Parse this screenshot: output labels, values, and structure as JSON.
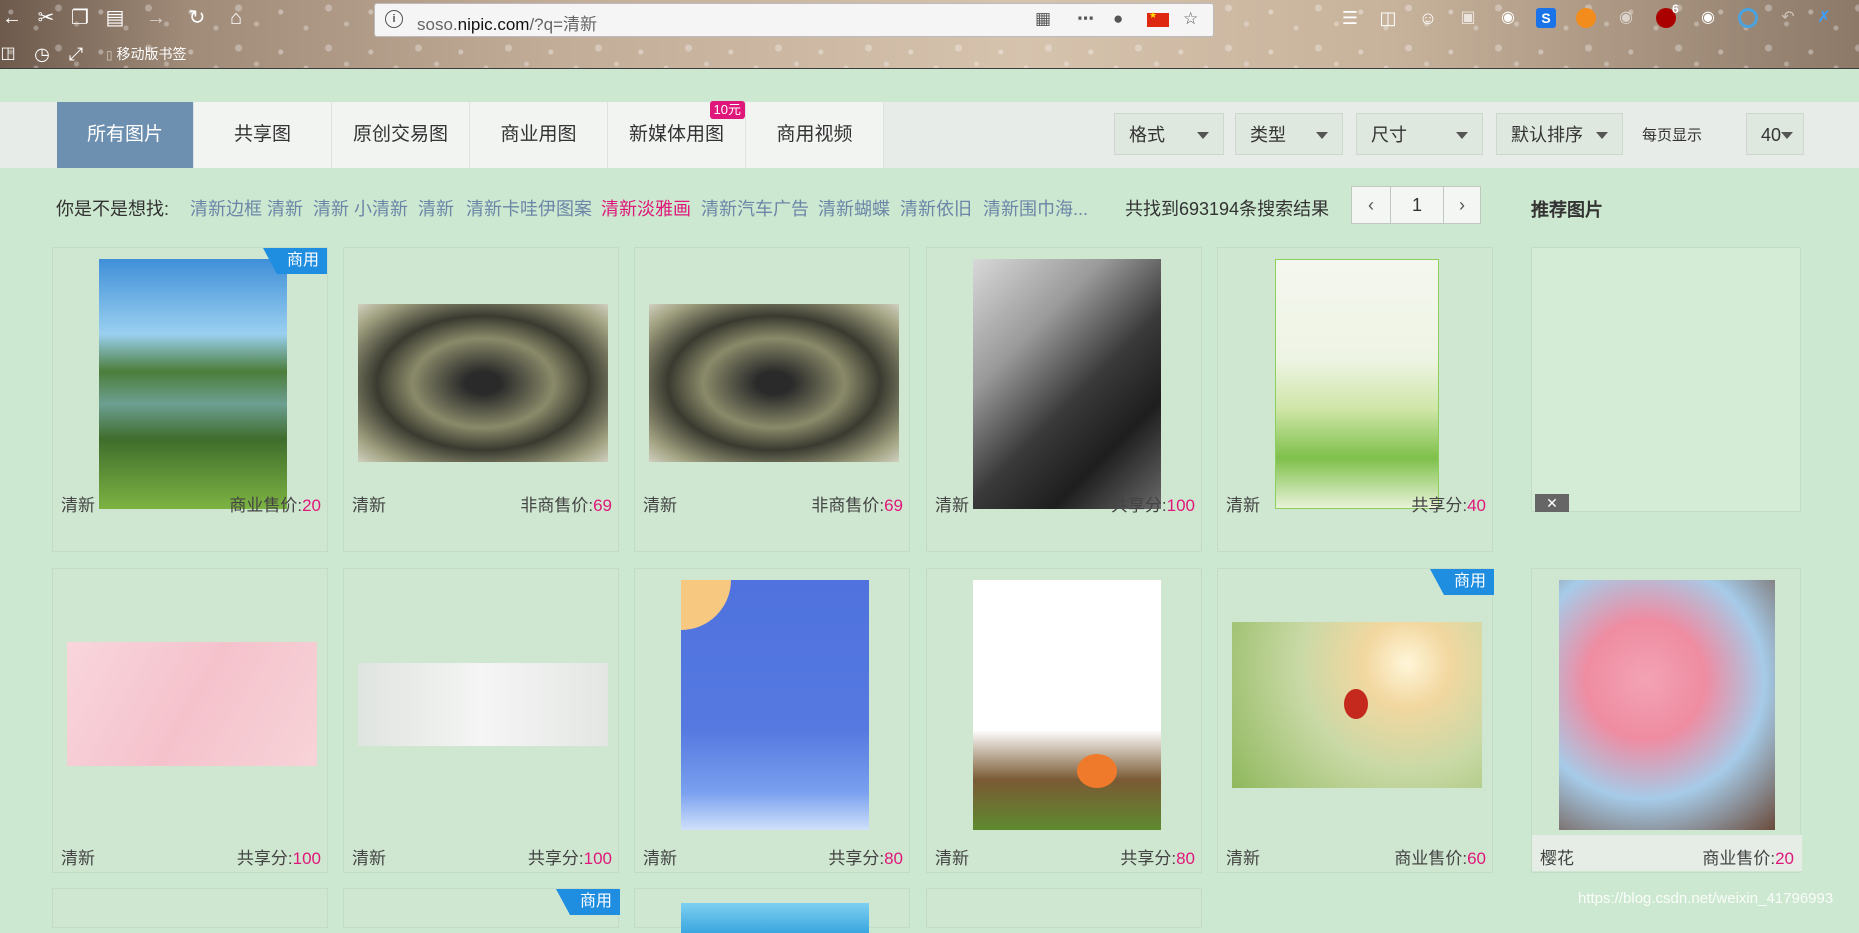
{
  "browser": {
    "url_host": "soso.",
    "url_domain": "nipic.com",
    "url_path": "/?q=清新",
    "bookmark_mobile": "移动版书签",
    "ext_badge": "6"
  },
  "tabs": [
    {
      "label": "所有图片"
    },
    {
      "label": "共享图"
    },
    {
      "label": "原创交易图"
    },
    {
      "label": "商业用图"
    },
    {
      "label": "新媒体用图",
      "badge": "10元"
    },
    {
      "label": "商用视频"
    }
  ],
  "filters": {
    "format": "格式",
    "type": "类型",
    "size": "尺寸",
    "sort": "默认排序",
    "per_page_label": "每页显示",
    "per_page_value": "40"
  },
  "suggestions": {
    "label": "你是不是想找:",
    "items": [
      "清新边框 清新",
      "清新 小清新",
      "清新",
      "清新卡哇伊图案",
      "清新淡雅画",
      "清新汽车广告",
      "清新蝴蝶",
      "清新依旧",
      "清新围巾海..."
    ],
    "highlighted_index": 4
  },
  "results": {
    "count_text": "共找到693194条搜索结果",
    "page": "1"
  },
  "recommend_title": "推荐图片",
  "badge_commercial": "商用",
  "cards": [
    {
      "tag": "清新",
      "price_label": "商业售价:",
      "price": "20"
    },
    {
      "tag": "清新",
      "price_label": "非商售价:",
      "price": "69"
    },
    {
      "tag": "清新",
      "price_label": "非商售价:",
      "price": "69"
    },
    {
      "tag": "清新",
      "price_label": "共享分:",
      "price": "100"
    },
    {
      "tag": "清新",
      "price_label": "共享分:",
      "price": "40"
    },
    {
      "tag": "清新",
      "price_label": "共享分:",
      "price": "100"
    },
    {
      "tag": "清新",
      "price_label": "共享分:",
      "price": "100"
    },
    {
      "tag": "清新",
      "price_label": "共享分:",
      "price": "80"
    },
    {
      "tag": "清新",
      "price_label": "共享分:",
      "price": "80"
    },
    {
      "tag": "清新",
      "price_label": "商业售价:",
      "price": "60"
    },
    {
      "tag": "樱花",
      "price_label": "商业售价:",
      "price": "20"
    }
  ],
  "close_label": "✕",
  "watermark": "https://blog.csdn.net/weixin_41796993"
}
